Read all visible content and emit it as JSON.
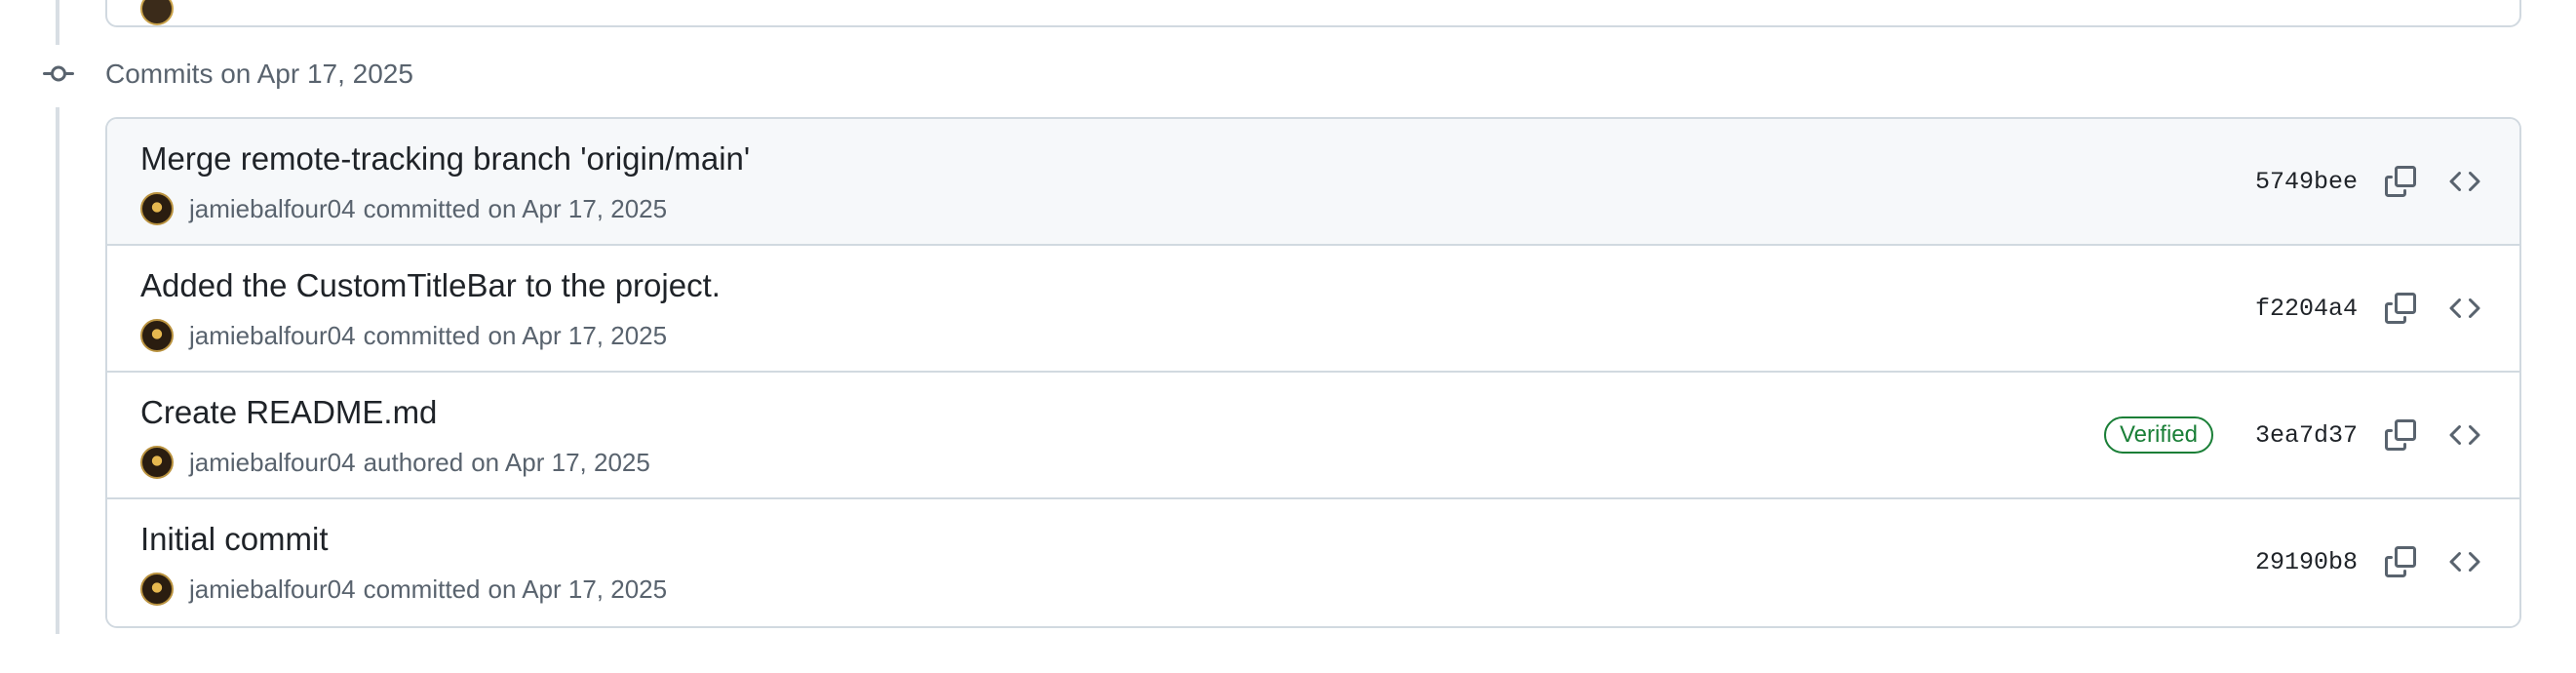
{
  "group": {
    "title": "Commits on Apr 17, 2025",
    "icon": "git-commit-icon"
  },
  "commits": [
    {
      "title": "Merge remote-tracking branch 'origin/main'",
      "author": "jamiebalfour04",
      "action": "committed",
      "date": "on Apr 17, 2025",
      "sha": "5749bee",
      "verified": ""
    },
    {
      "title": "Added the CustomTitleBar to the project.",
      "author": "jamiebalfour04",
      "action": "committed",
      "date": "on Apr 17, 2025",
      "sha": "f2204a4",
      "verified": ""
    },
    {
      "title": "Create README.md",
      "author": "jamiebalfour04",
      "action": "authored",
      "date": "on Apr 17, 2025",
      "sha": "3ea7d37",
      "verified": "Verified"
    },
    {
      "title": "Initial commit",
      "author": "jamiebalfour04",
      "action": "committed",
      "date": "on Apr 17, 2025",
      "sha": "29190b8",
      "verified": ""
    }
  ],
  "icons": {
    "copy": "copy-icon",
    "browse": "code-icon"
  },
  "colors": {
    "verified": "#1a7f37",
    "highlight_row": "#f6f8fa",
    "border": "#d1d9e0"
  }
}
